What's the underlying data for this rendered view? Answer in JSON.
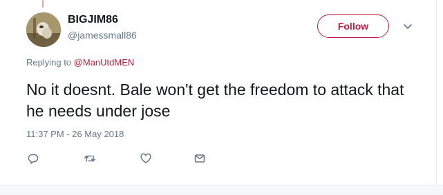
{
  "tweet": {
    "author": {
      "display_name": "BIGJIM86",
      "handle": "@jamessmall86",
      "avatar_icon": "avatar-photo"
    },
    "follow_button_label": "Follow",
    "caret_icon": "chevron-down-icon",
    "replying_prefix": "Replying to",
    "replying_to": "@ManUtdMEN",
    "text": "No it doesnt. Bale won't get the freedom to attack that he needs under jose",
    "timestamp": "11:37 PM - 26 May 2018",
    "actions": [
      {
        "name": "reply",
        "icon": "reply-icon"
      },
      {
        "name": "retweet",
        "icon": "retweet-icon"
      },
      {
        "name": "like",
        "icon": "heart-icon"
      },
      {
        "name": "direct-message",
        "icon": "envelope-icon"
      }
    ]
  },
  "colors": {
    "accent": "#c5193a",
    "text_primary": "#14171a",
    "text_secondary": "#657786",
    "border": "#e6ecf0"
  }
}
